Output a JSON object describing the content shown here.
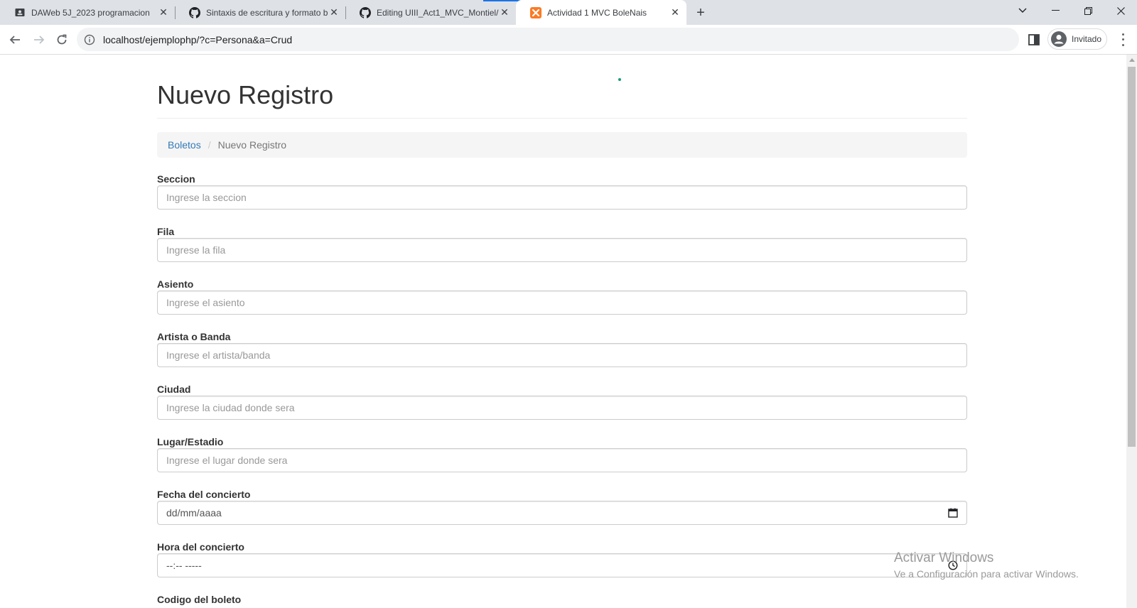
{
  "browser": {
    "tabs": [
      {
        "label": "DAWeb 5J_2023 programacion",
        "icon": "classroom-icon",
        "active": false
      },
      {
        "label": "Sintaxis de escritura y formato b",
        "icon": "github-icon",
        "active": false
      },
      {
        "label": "Editing UIII_Act1_MVC_Montiel/",
        "icon": "github-icon",
        "active": false
      },
      {
        "label": "Actividad 1 MVC BoleNais",
        "icon": "xampp-icon",
        "active": true
      }
    ],
    "address": "localhost/ejemplophp/?c=Persona&a=Crud",
    "profile_label": "Invitado"
  },
  "page": {
    "title": "Nuevo Registro",
    "breadcrumb": {
      "link": "Boletos",
      "separator": "/",
      "current": "Nuevo Registro"
    },
    "fields": [
      {
        "label": "Seccion",
        "placeholder": "Ingrese la seccion",
        "type": "text"
      },
      {
        "label": "Fila",
        "placeholder": "Ingrese la fila",
        "type": "text"
      },
      {
        "label": "Asiento",
        "placeholder": "Ingrese el asiento",
        "type": "text"
      },
      {
        "label": "Artista o Banda",
        "placeholder": "Ingrese el artista/banda",
        "type": "text"
      },
      {
        "label": "Ciudad",
        "placeholder": "Ingrese la ciudad donde sera",
        "type": "text"
      },
      {
        "label": "Lugar/Estadio",
        "placeholder": "Ingrese el lugar donde sera",
        "type": "text"
      },
      {
        "label": "Fecha del concierto",
        "value": "dd/mm/aaaa",
        "type": "date",
        "icon": "calendar-icon"
      },
      {
        "label": "Hora del concierto",
        "value": "--:-- -----",
        "type": "time",
        "icon": "clock-icon"
      },
      {
        "label": "Codigo del boleto"
      }
    ]
  },
  "watermark": {
    "line1": "Activar Windows",
    "line2": "Ve a Configuración para activar Windows."
  },
  "colors": {
    "link": "#337ab7",
    "tabbar": "#dee1e6",
    "breadcrumb_bg": "#f5f5f5"
  }
}
